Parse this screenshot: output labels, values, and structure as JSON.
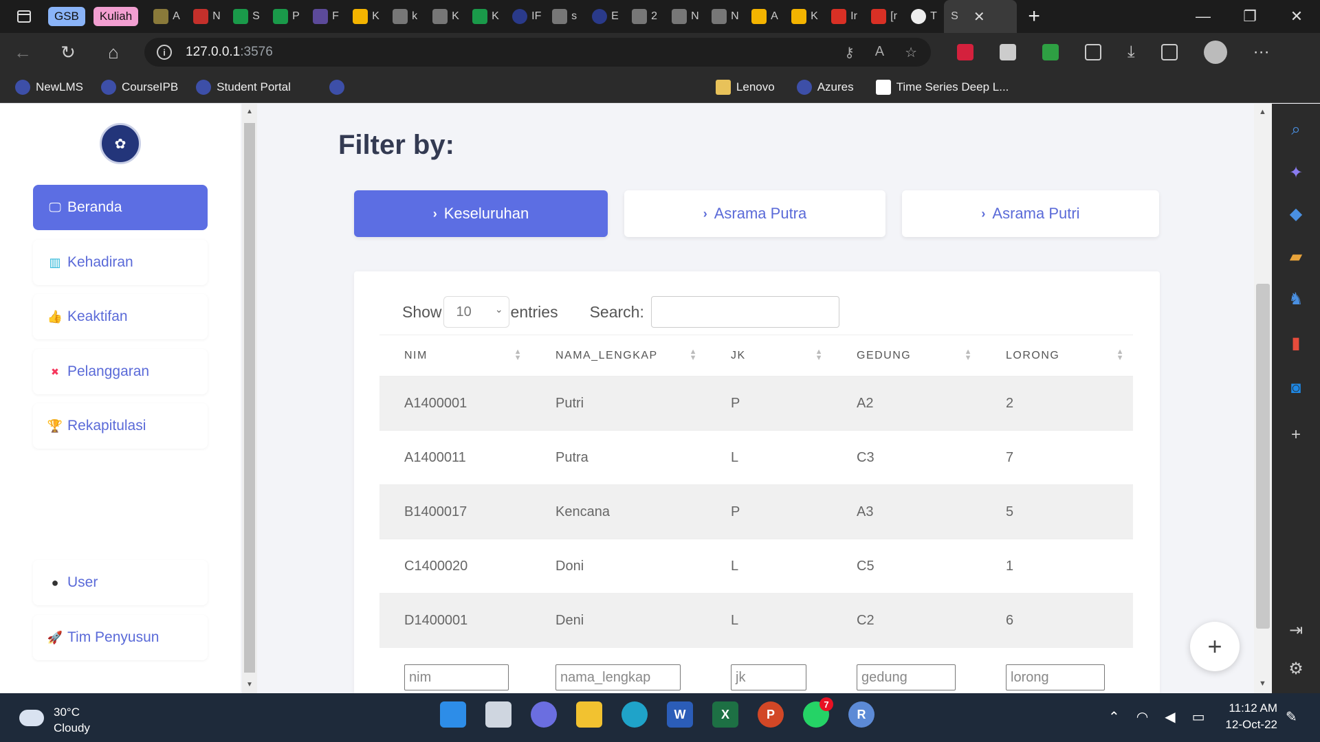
{
  "browser": {
    "tab_groups": [
      "GSB",
      "Kuliah"
    ],
    "tab_letters": [
      "A",
      "N",
      "S",
      "P",
      "F",
      "K",
      "k",
      "K",
      "K",
      "IF",
      "s",
      "E",
      "2",
      "N",
      "N",
      "A",
      "K",
      "Ir",
      "[r",
      "T"
    ],
    "active_tab_letter": "S",
    "url_host": "127.0.0.1",
    "url_port": ":3576",
    "bookmarks": [
      "NewLMS",
      "CourseIPB",
      "Student Portal",
      "Lenovo",
      "Azures",
      "Time Series Deep L..."
    ]
  },
  "sidebar": {
    "items": [
      {
        "label": "Beranda",
        "icon": "monitor-icon"
      },
      {
        "label": "Kehadiran",
        "icon": "books-icon"
      },
      {
        "label": "Keaktifan",
        "icon": "thumbs-up-icon"
      },
      {
        "label": "Pelanggaran",
        "icon": "x-icon"
      },
      {
        "label": "Rekapitulasi",
        "icon": "trophy-icon"
      }
    ],
    "bottom_items": [
      {
        "label": "User",
        "icon": "user-circle-icon"
      },
      {
        "label": "Tim Penyusun",
        "icon": "rocket-icon"
      }
    ]
  },
  "main": {
    "title": "Filter by:",
    "filters": [
      "Keseluruhan",
      "Asrama Putra",
      "Asrama Putri"
    ],
    "table": {
      "show_label": "Show",
      "entries_value": "10",
      "entries_label": "entries",
      "search_label": "Search:",
      "columns": [
        "NIM",
        "NAMA_LENGKAP",
        "JK",
        "GEDUNG",
        "LORONG"
      ],
      "rows": [
        [
          "A1400001",
          "Putri",
          "P",
          "A2",
          "2"
        ],
        [
          "A1400011",
          "Putra",
          "L",
          "C3",
          "7"
        ],
        [
          "B1400017",
          "Kencana",
          "P",
          "A3",
          "5"
        ],
        [
          "C1400020",
          "Doni",
          "L",
          "C5",
          "1"
        ],
        [
          "D1400001",
          "Deni",
          "L",
          "C2",
          "6"
        ]
      ],
      "footer_inputs": [
        "nim",
        "nama_lengkap",
        "jk",
        "gedung",
        "lorong"
      ]
    }
  },
  "taskbar": {
    "temperature": "30°C",
    "weather": "Cloudy",
    "time": "11:12 AM",
    "date": "12-Oct-22",
    "whatsapp_badge": "7",
    "r_app_letter": "R"
  },
  "colors": {
    "accent": "#5c6ee3",
    "link": "#5a6ad8",
    "chrome_dark": "#2b2b2b",
    "taskbar": "#1e2a3a"
  }
}
